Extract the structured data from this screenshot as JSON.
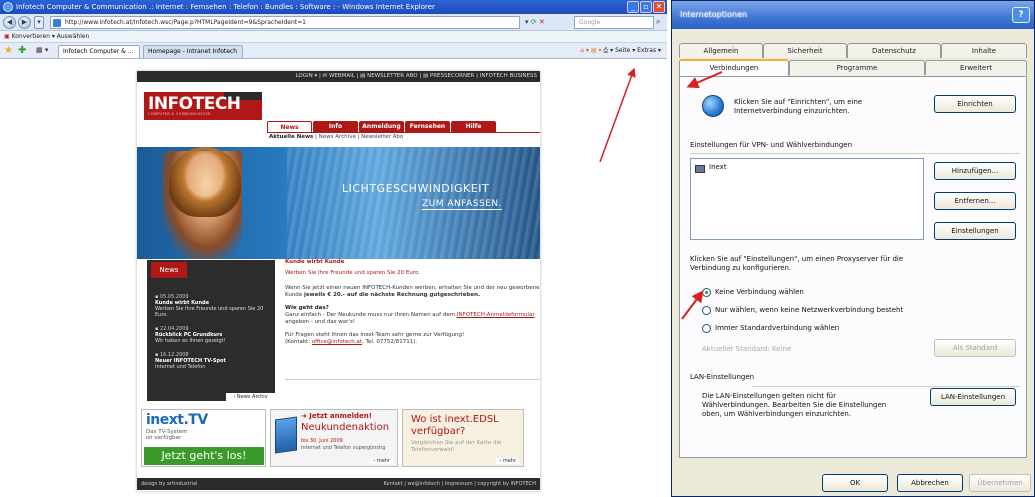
{
  "ie": {
    "title": "Infotech Computer & Communication .: Internet : Fernsehen : Telefon : Bundles : Software : - Windows Internet Explorer",
    "url": "http://www.infotech.at/Infotech.wsc/Page.p?HTMLPageIdent=9&SpracheIdent=1",
    "search_placeholder": "Google",
    "links_bar": "Konvertieren  ▾  Auswählen",
    "tabs": [
      "Infotech Computer & ...",
      "Homepage - Intranet Infotech"
    ],
    "toolbar_right": "Seite ▾   Extras ▾"
  },
  "site": {
    "topnav": "LOGIN ▾ | ✉ WEBMAIL | ▤ NEWSLETTER ABO | ▤ PRESSECORNER | INFOTECH BUSINESS",
    "logo": "INFOTECH",
    "logo_sub": "COMPUTER & COMMUNICATION",
    "nav": [
      "News",
      "Info",
      "Anmeldung",
      "Fernsehen",
      "Hilfe"
    ],
    "subnav_active": "Aktuelle News",
    "subnav_rest": " | News Archive | Newsletter Abo",
    "banner_line1": "LICHTGESCHWINDIGKEIT",
    "banner_line2": "ZUM ANFASSEN.",
    "news_header": "News",
    "news": [
      {
        "date": "05.05.2009",
        "title": "Kunde wirbt Kunde",
        "text": "Werben Sie Ihre Freunde und sparen Sie 20 Euro."
      },
      {
        "date": "22.04.2009",
        "title": "Rückblick PC Grundkurs",
        "text": "Wir haben es Ihnen gezeigt!"
      },
      {
        "date": "16.12.2008",
        "title": "Neuer INFOTECH TV-Spot",
        "text": "Internet und Telefon"
      }
    ],
    "news_archive": "› News Archiv",
    "article": {
      "heading": "Kunde wirbt Kunde",
      "lead": "Werben Sie Ihre Freunde und sparen Sie 20 Euro.",
      "p1_a": "Wenn Sie jetzt einen neuen INFOTECH-Kunden werben, erhalten Sie und der neu geworbene Kunde ",
      "p1_b": "jeweils € 20.- auf die nächste Rechnung gutgeschrieben.",
      "q": "Wie geht das?",
      "p2_a": "Ganz einfach - Der Neukunde muss nur Ihren Namen auf dem ",
      "p2_link": "INFOTECH-Anmeldeformular",
      "p2_b": " angeben - und das war's!",
      "p3_a": "Für Fragen steht Ihnen das inext-Team sehr gerne zur Verfügung!",
      "p3_b": "(Kontakt: ",
      "p3_link": "office@infotech.at",
      "p3_c": ", Tel. 07752/81711)."
    },
    "ad1": {
      "title": "inext.TV",
      "sub1": "Das TV-System",
      "sub2": "ist verfügbar",
      "cta": "Jetzt geht's los!"
    },
    "ad2": {
      "top": "➜ Jetzt anmelden!",
      "title": "Neukundenaktion",
      "date": "bis 30. Juni 2009",
      "sub": "Internet und Telefon supergünstig",
      "more": "› mehr"
    },
    "ad3": {
      "title1": "Wo ist inext.EDSL",
      "title2": "verfügbar?",
      "sub": "Vergleichen Sie auf der Karte die Telefonvorwahl!",
      "more": "› mehr"
    },
    "footer_left": "design by artindustrial",
    "footer_right": "Kontakt | we@infotech | Impressum | copyright by INFOTECH"
  },
  "dialog": {
    "title": "Internetoptionen",
    "help": "?",
    "tabs_row1": [
      "Allgemein",
      "Sicherheit",
      "Datenschutz",
      "Inhalte"
    ],
    "tabs_row2": [
      "Verbindungen",
      "Programme",
      "Erweitert"
    ],
    "setup_text": "Klicken Sie auf \"Einrichten\", um eine Internetverbindung einzurichten.",
    "setup_btn": "Einrichten",
    "vpn_label": "Einstellungen für VPN- und Wählverbindungen",
    "vpn_item": "Inext",
    "btn_add": "Hinzufügen...",
    "btn_remove": "Entfernen...",
    "btn_settings": "Einstellungen",
    "proxy_text": "Klicken Sie auf \"Einstellungen\", um einen Proxyserver für die Verbindung zu konfigurieren.",
    "radio1": "Keine Verbindung wählen",
    "radio2": "Nur wählen, wenn keine Netzwerkverbindung besteht",
    "radio3": "Immer Standardverbindung wählen",
    "current_default": "Aktueller Standard:  Keine",
    "btn_default": "Als Standard",
    "lan_header": "LAN-Einstellungen",
    "lan_text": "Die LAN-Einstellungen gelten nicht für Wählverbindungen. Bearbeiten Sie die Einstellungen oben, um Wählverbindungen einzurichten.",
    "btn_lan": "LAN-Einstellungen",
    "ok": "OK",
    "cancel": "Abbrechen",
    "apply": "Übernehmen"
  }
}
